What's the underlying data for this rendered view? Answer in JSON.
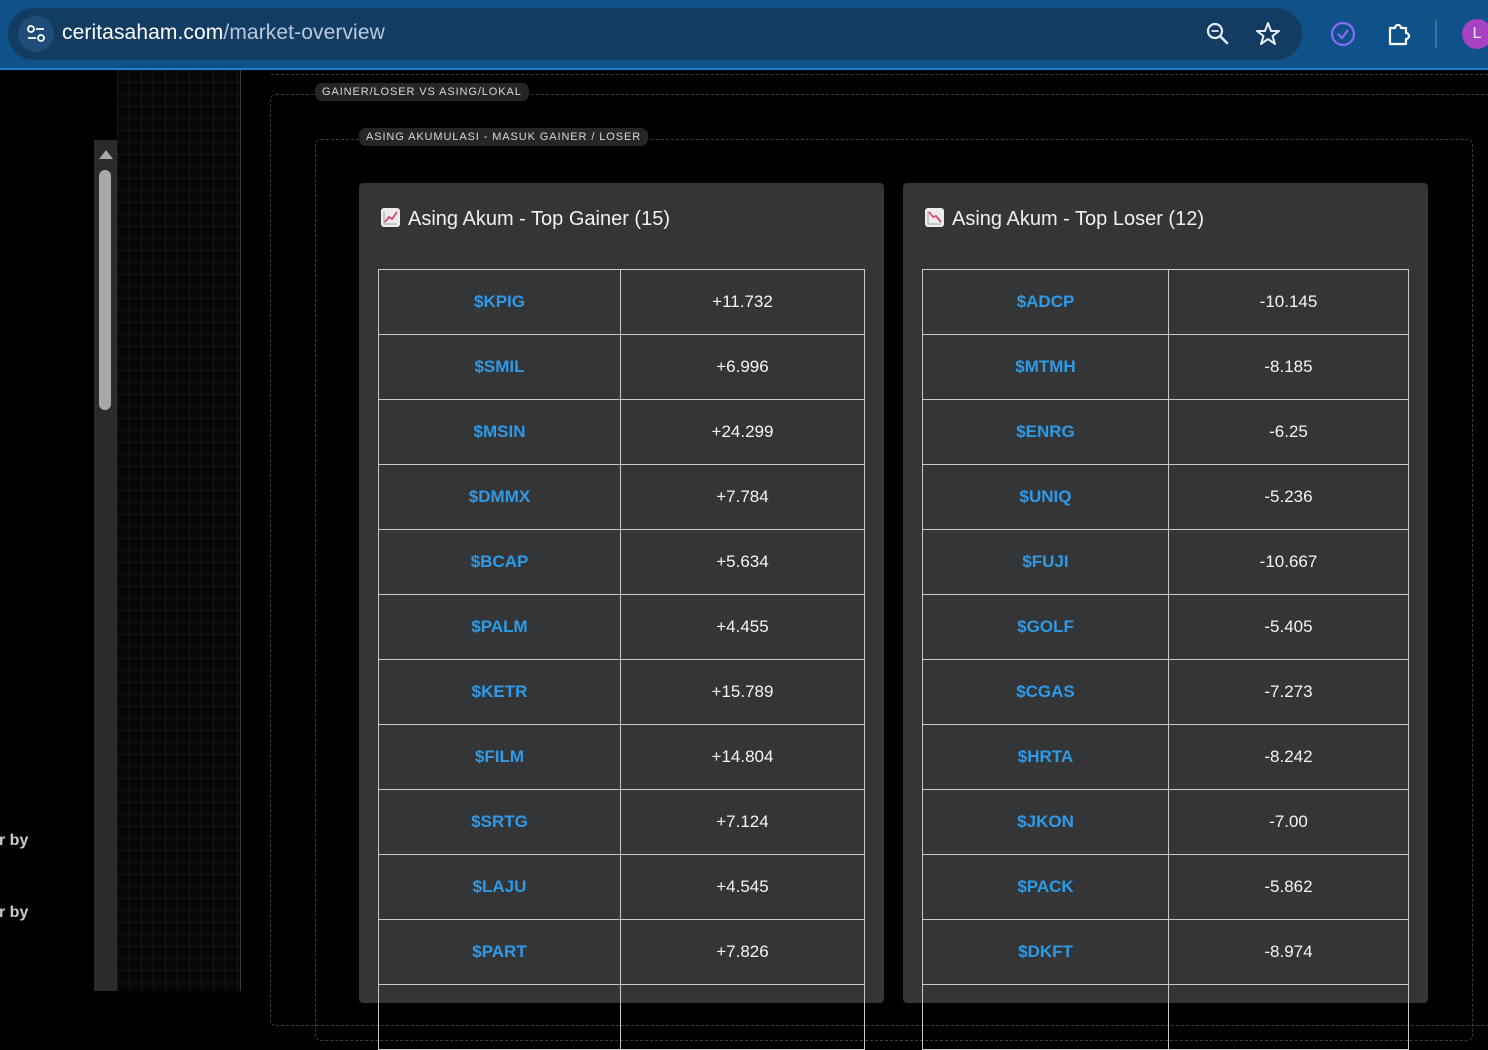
{
  "browser": {
    "url_domain": "ceritasaham.com",
    "url_path": "/market-overview",
    "avatar_letter": "L"
  },
  "left_panel": {
    "fragments": [
      "r by",
      "r by"
    ]
  },
  "sections": {
    "outer_legend": "GAINER/LOSER VS ASING/LOKAL",
    "inner_legend": "ASING AKUMULASI - MASUK GAINER / LOSER"
  },
  "gainer": {
    "title": "Asing Akum - Top Gainer (15)",
    "icon": "chart-increasing-icon",
    "rows": [
      {
        "ticker": "$KPIG",
        "value": "+11.732"
      },
      {
        "ticker": "$SMIL",
        "value": "+6.996"
      },
      {
        "ticker": "$MSIN",
        "value": "+24.299"
      },
      {
        "ticker": "$DMMX",
        "value": "+7.784"
      },
      {
        "ticker": "$BCAP",
        "value": "+5.634"
      },
      {
        "ticker": "$PALM",
        "value": "+4.455"
      },
      {
        "ticker": "$KETR",
        "value": "+15.789"
      },
      {
        "ticker": "$FILM",
        "value": "+14.804"
      },
      {
        "ticker": "$SRTG",
        "value": "+7.124"
      },
      {
        "ticker": "$LAJU",
        "value": "+4.545"
      },
      {
        "ticker": "$PART",
        "value": "+7.826"
      },
      {
        "ticker": "",
        "value": ""
      }
    ]
  },
  "loser": {
    "title": "Asing Akum - Top Loser (12)",
    "icon": "chart-decreasing-icon",
    "rows": [
      {
        "ticker": "$ADCP",
        "value": "-10.145"
      },
      {
        "ticker": "$MTMH",
        "value": "-8.185"
      },
      {
        "ticker": "$ENRG",
        "value": "-6.25"
      },
      {
        "ticker": "$UNIQ",
        "value": "-5.236"
      },
      {
        "ticker": "$FUJI",
        "value": "-10.667"
      },
      {
        "ticker": "$GOLF",
        "value": "-5.405"
      },
      {
        "ticker": "$CGAS",
        "value": "-7.273"
      },
      {
        "ticker": "$HRTA",
        "value": "-8.242"
      },
      {
        "ticker": "$JKON",
        "value": "-7.00"
      },
      {
        "ticker": "$PACK",
        "value": "-5.862"
      },
      {
        "ticker": "$DKFT",
        "value": "-8.974"
      },
      {
        "ticker": "",
        "value": ""
      }
    ]
  },
  "colors": {
    "ticker": "#2f9ae7",
    "card_bg": "#333537",
    "browser_bar": "#0f5289"
  }
}
